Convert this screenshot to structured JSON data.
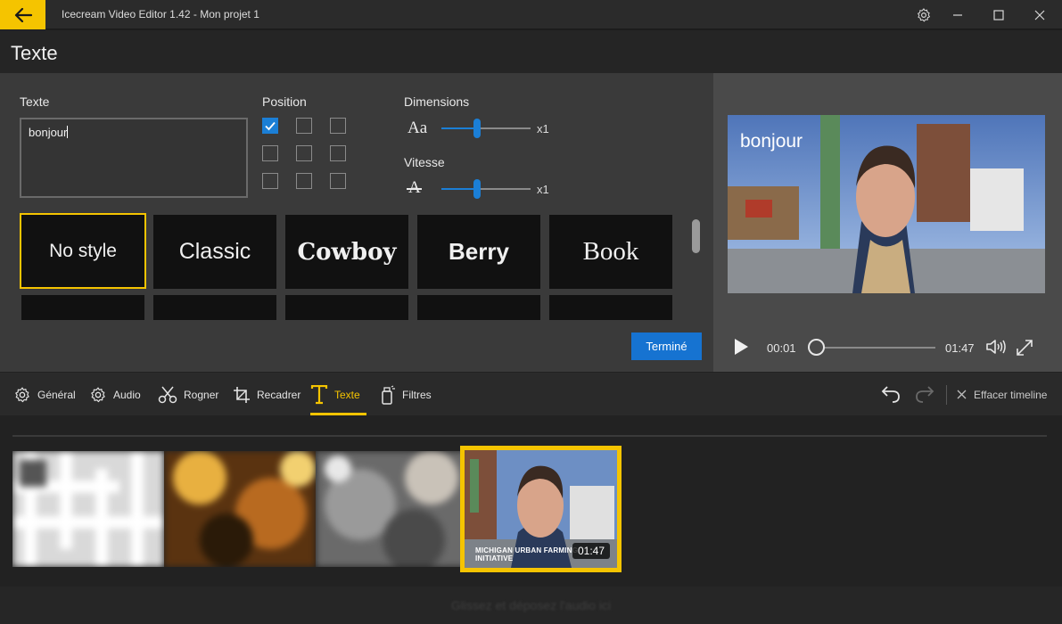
{
  "window": {
    "title": "Icecream Video Editor 1.42 - Mon projet 1"
  },
  "header": {
    "title": "Texte"
  },
  "editor": {
    "text_label": "Texte",
    "text_value": "bonjour",
    "position_label": "Position",
    "position_selected": "top-left",
    "dimensions_label": "Dimensions",
    "dimensions_icon_text": "Aa",
    "dimensions_value": 0.4,
    "dimensions_multiplier": "x1",
    "speed_label": "Vitesse",
    "speed_icon_text": "A",
    "speed_value": 0.4,
    "speed_multiplier": "x1",
    "styles": [
      {
        "label": "No style",
        "selected": true
      },
      {
        "label": "Classic",
        "selected": false
      },
      {
        "label": "Cowboy",
        "selected": false
      },
      {
        "label": "Berry",
        "selected": false
      },
      {
        "label": "Book",
        "selected": false
      }
    ],
    "done_label": "Terminé"
  },
  "preview": {
    "overlay_text": "bonjour",
    "current_time": "00:01",
    "total_time": "01:47",
    "progress": 0.0
  },
  "toolbar": {
    "tools": [
      {
        "label": "Général",
        "icon": "gear-icon"
      },
      {
        "label": "Audio",
        "icon": "gear-icon"
      },
      {
        "label": "Rogner",
        "icon": "scissors-icon"
      },
      {
        "label": "Recadrer",
        "icon": "crop-icon"
      },
      {
        "label": "Texte",
        "icon": "text-icon",
        "active": true
      },
      {
        "label": "Filtres",
        "icon": "filter-icon"
      }
    ],
    "clear_label": "Effacer timeline"
  },
  "timeline": {
    "selected_clip_duration": "01:47",
    "selected_clip_caption": "MICHIGAN URBAN FARMING INITIATIVE",
    "audio_drop_label": "Glissez et déposez l'audio ici"
  },
  "colors": {
    "accent": "#f5c400",
    "primary": "#1673d1"
  }
}
